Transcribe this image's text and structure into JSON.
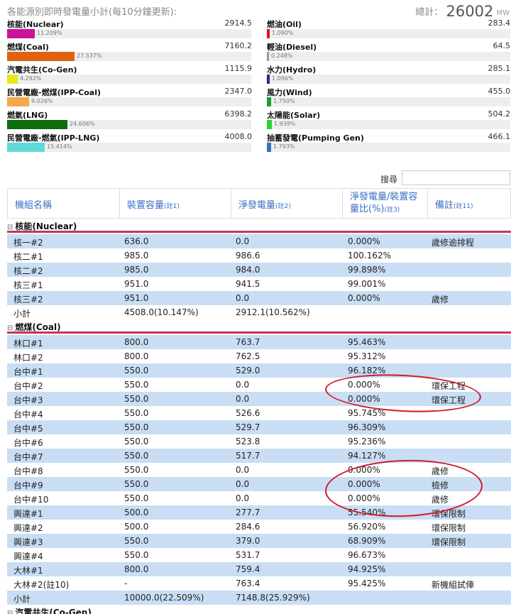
{
  "summary": {
    "title": "各能源別即時發電量小計(每10分鐘更新):",
    "total_label": "總計：",
    "total_value": "26002",
    "total_unit": "MW",
    "left": [
      {
        "name": "核能(Nuclear)",
        "value": "2914.5",
        "pct_text": "11.209%",
        "pct": 11.209,
        "color": "#c8139b"
      },
      {
        "name": "燃煤(Coal)",
        "value": "7160.2",
        "pct_text": "27.537%",
        "pct": 27.537,
        "color": "#e0620f"
      },
      {
        "name": "汽電共生(Co-Gen)",
        "value": "1115.9",
        "pct_text": "4.292%",
        "pct": 4.292,
        "color": "#e9e61a"
      },
      {
        "name": "民營電廠-燃煤(IPP-Coal)",
        "value": "2347.0",
        "pct_text": "9.026%",
        "pct": 9.026,
        "color": "#f6a84a"
      },
      {
        "name": "燃氣(LNG)",
        "value": "6398.2",
        "pct_text": "24.606%",
        "pct": 24.606,
        "color": "#0e6d0e"
      },
      {
        "name": "民營電廠-燃氣(IPP-LNG)",
        "value": "4008.0",
        "pct_text": "15.414%",
        "pct": 15.414,
        "color": "#5fd9d9"
      }
    ],
    "right": [
      {
        "name": "燃油(Oil)",
        "value": "283.4",
        "pct_text": "1.090%",
        "pct": 1.09,
        "color": "#e0141c"
      },
      {
        "name": "輕油(Diesel)",
        "value": "64.5",
        "pct_text": "0.248%",
        "pct": 0.248,
        "color": "#999999"
      },
      {
        "name": "水力(Hydro)",
        "value": "285.1",
        "pct_text": "1.096%",
        "pct": 1.096,
        "color": "#1a2a9c"
      },
      {
        "name": "風力(Wind)",
        "value": "455.0",
        "pct_text": "1.750%",
        "pct": 1.75,
        "color": "#1e9a3a"
      },
      {
        "name": "太陽能(Solar)",
        "value": "504.2",
        "pct_text": "1.939%",
        "pct": 1.939,
        "color": "#2bd42b"
      },
      {
        "name": "抽蓄發電(Pumping Gen)",
        "value": "466.1",
        "pct_text": "1.793%",
        "pct": 1.793,
        "color": "#3a6fc4"
      }
    ]
  },
  "search": {
    "label": "搜尋",
    "value": ""
  },
  "table": {
    "headers": [
      {
        "text": "機組名稱",
        "note": ""
      },
      {
        "text": "裝置容量",
        "note": "(註1)"
      },
      {
        "text": "淨發電量",
        "note": "(註2)"
      },
      {
        "text": "淨發電量/裝置容量比(%)",
        "note": "(註3)"
      },
      {
        "text": "備註",
        "note": "(註11)"
      }
    ],
    "groups": [
      {
        "title": "核能(Nuclear)",
        "rows": [
          [
            "核一#2",
            "636.0",
            "0.0",
            "0.000%",
            "歲修逾排程"
          ],
          [
            "核二#1",
            "985.0",
            "986.6",
            "100.162%",
            ""
          ],
          [
            "核二#2",
            "985.0",
            "984.0",
            "99.898%",
            ""
          ],
          [
            "核三#1",
            "951.0",
            "941.5",
            "99.001%",
            ""
          ],
          [
            "核三#2",
            "951.0",
            "0.0",
            "0.000%",
            "歲修"
          ],
          [
            "小計",
            "4508.0(10.147%)",
            "2912.1(10.562%)",
            "",
            ""
          ]
        ]
      },
      {
        "title": "燃煤(Coal)",
        "rows": [
          [
            "林口#1",
            "800.0",
            "763.7",
            "95.463%",
            ""
          ],
          [
            "林口#2",
            "800.0",
            "762.5",
            "95.312%",
            ""
          ],
          [
            "台中#1",
            "550.0",
            "529.0",
            "96.182%",
            ""
          ],
          [
            "台中#2",
            "550.0",
            "0.0",
            "0.000%",
            "環保工程"
          ],
          [
            "台中#3",
            "550.0",
            "0.0",
            "0.000%",
            "環保工程"
          ],
          [
            "台中#4",
            "550.0",
            "526.6",
            "95.745%",
            ""
          ],
          [
            "台中#5",
            "550.0",
            "529.7",
            "96.309%",
            ""
          ],
          [
            "台中#6",
            "550.0",
            "523.8",
            "95.236%",
            ""
          ],
          [
            "台中#7",
            "550.0",
            "517.7",
            "94.127%",
            ""
          ],
          [
            "台中#8",
            "550.0",
            "0.0",
            "0.000%",
            "歲修"
          ],
          [
            "台中#9",
            "550.0",
            "0.0",
            "0.000%",
            "檢修"
          ],
          [
            "台中#10",
            "550.0",
            "0.0",
            "0.000%",
            "歲修"
          ],
          [
            "興達#1",
            "500.0",
            "277.7",
            "55.540%",
            "環保限制"
          ],
          [
            "興達#2",
            "500.0",
            "284.6",
            "56.920%",
            "環保限制"
          ],
          [
            "興達#3",
            "550.0",
            "379.0",
            "68.909%",
            "環保限制"
          ],
          [
            "興達#4",
            "550.0",
            "531.7",
            "96.673%",
            ""
          ],
          [
            "大林#1",
            "800.0",
            "759.4",
            "94.925%",
            ""
          ],
          [
            "大林#2(註10)",
            "-",
            "763.4",
            "95.425%",
            "新機組試俥"
          ],
          [
            "小計",
            "10000.0(22.509%)",
            "7148.8(25.929%)",
            "",
            ""
          ]
        ]
      }
    ],
    "tail_group": "汽電共生(Co-Gen)"
  }
}
